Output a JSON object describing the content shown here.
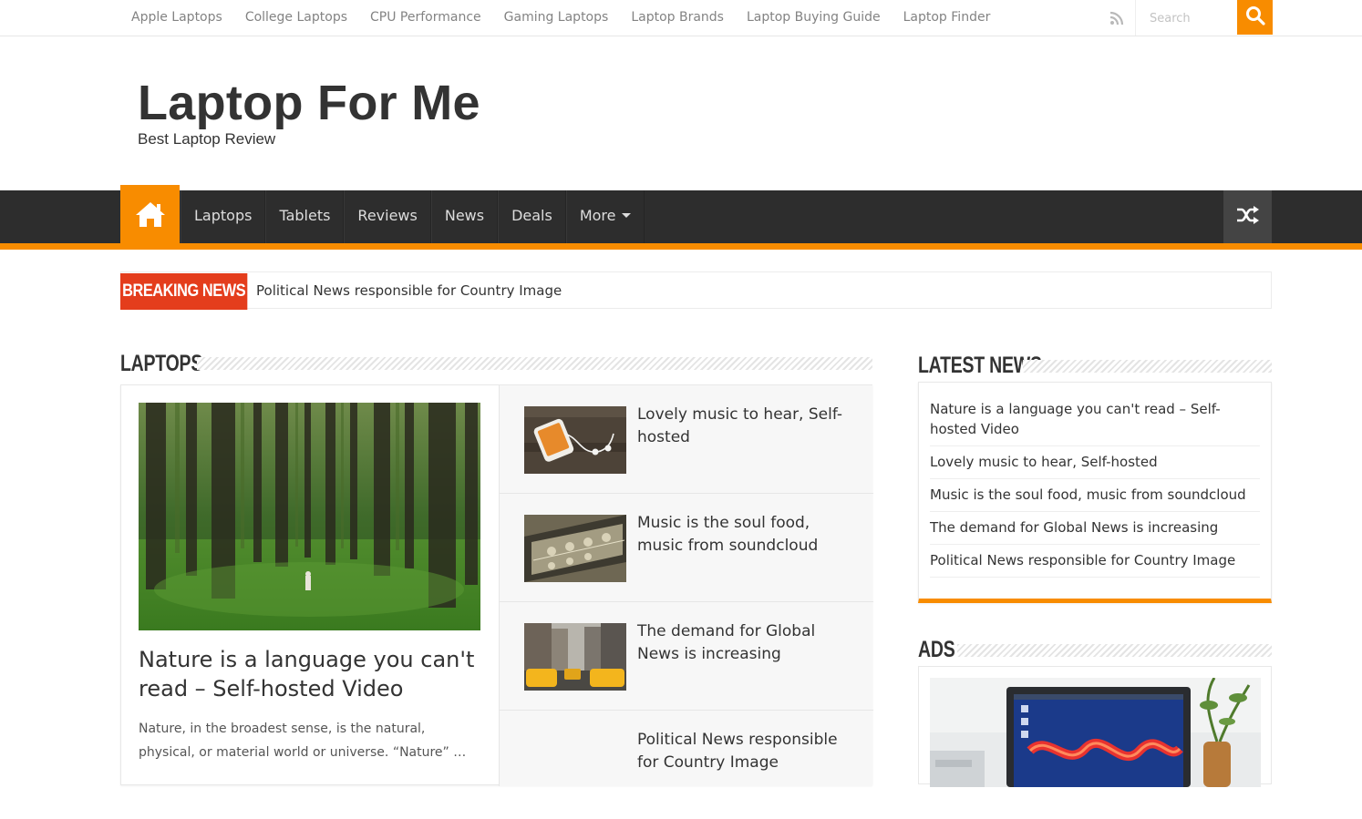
{
  "topbar": {
    "links": [
      "Apple Laptops",
      "College Laptops",
      "CPU Performance",
      "Gaming Laptops",
      "Laptop Brands",
      "Laptop Buying Guide",
      "Laptop Finder"
    ],
    "search_placeholder": "Search"
  },
  "header": {
    "site_title": "Laptop For Me",
    "tagline": "Best Laptop Review"
  },
  "mainnav": {
    "items": [
      "Laptops",
      "Tablets",
      "Reviews",
      "News",
      "Deals"
    ],
    "more_label": "More"
  },
  "breaking": {
    "label": "BREAKING NEWS",
    "headline": "Political News responsible for Country Image"
  },
  "laptops": {
    "section_title": "LAPTOPS",
    "featured": {
      "title": "Nature is a language you can't read – Self-hosted Video",
      "excerpt": "Nature, in the broadest sense, is the natural, physical, or material world or universe. “Nature” …"
    },
    "items": [
      {
        "title": "Lovely music to hear, Self-hosted"
      },
      {
        "title": "Music is the soul food, music from soundcloud"
      },
      {
        "title": "The demand for Global News is increasing"
      },
      {
        "title": "Political News responsible for Country Image"
      }
    ]
  },
  "latest_news": {
    "section_title": "LATEST NEWS",
    "items": [
      "Nature is a language you can't read – Self-hosted Video",
      "Lovely music to hear, Self-hosted",
      "Music is the soul food, music from soundcloud",
      "The demand for Global News is increasing",
      "Political News responsible for Country Image"
    ]
  },
  "ads": {
    "section_title": "ADS"
  },
  "colors": {
    "accent": "#f88c00",
    "nav_bg": "#2d2d2d",
    "breaking": "#e43d1c"
  },
  "icons": [
    "rss-icon",
    "search-icon",
    "home-icon",
    "shuffle-icon"
  ]
}
